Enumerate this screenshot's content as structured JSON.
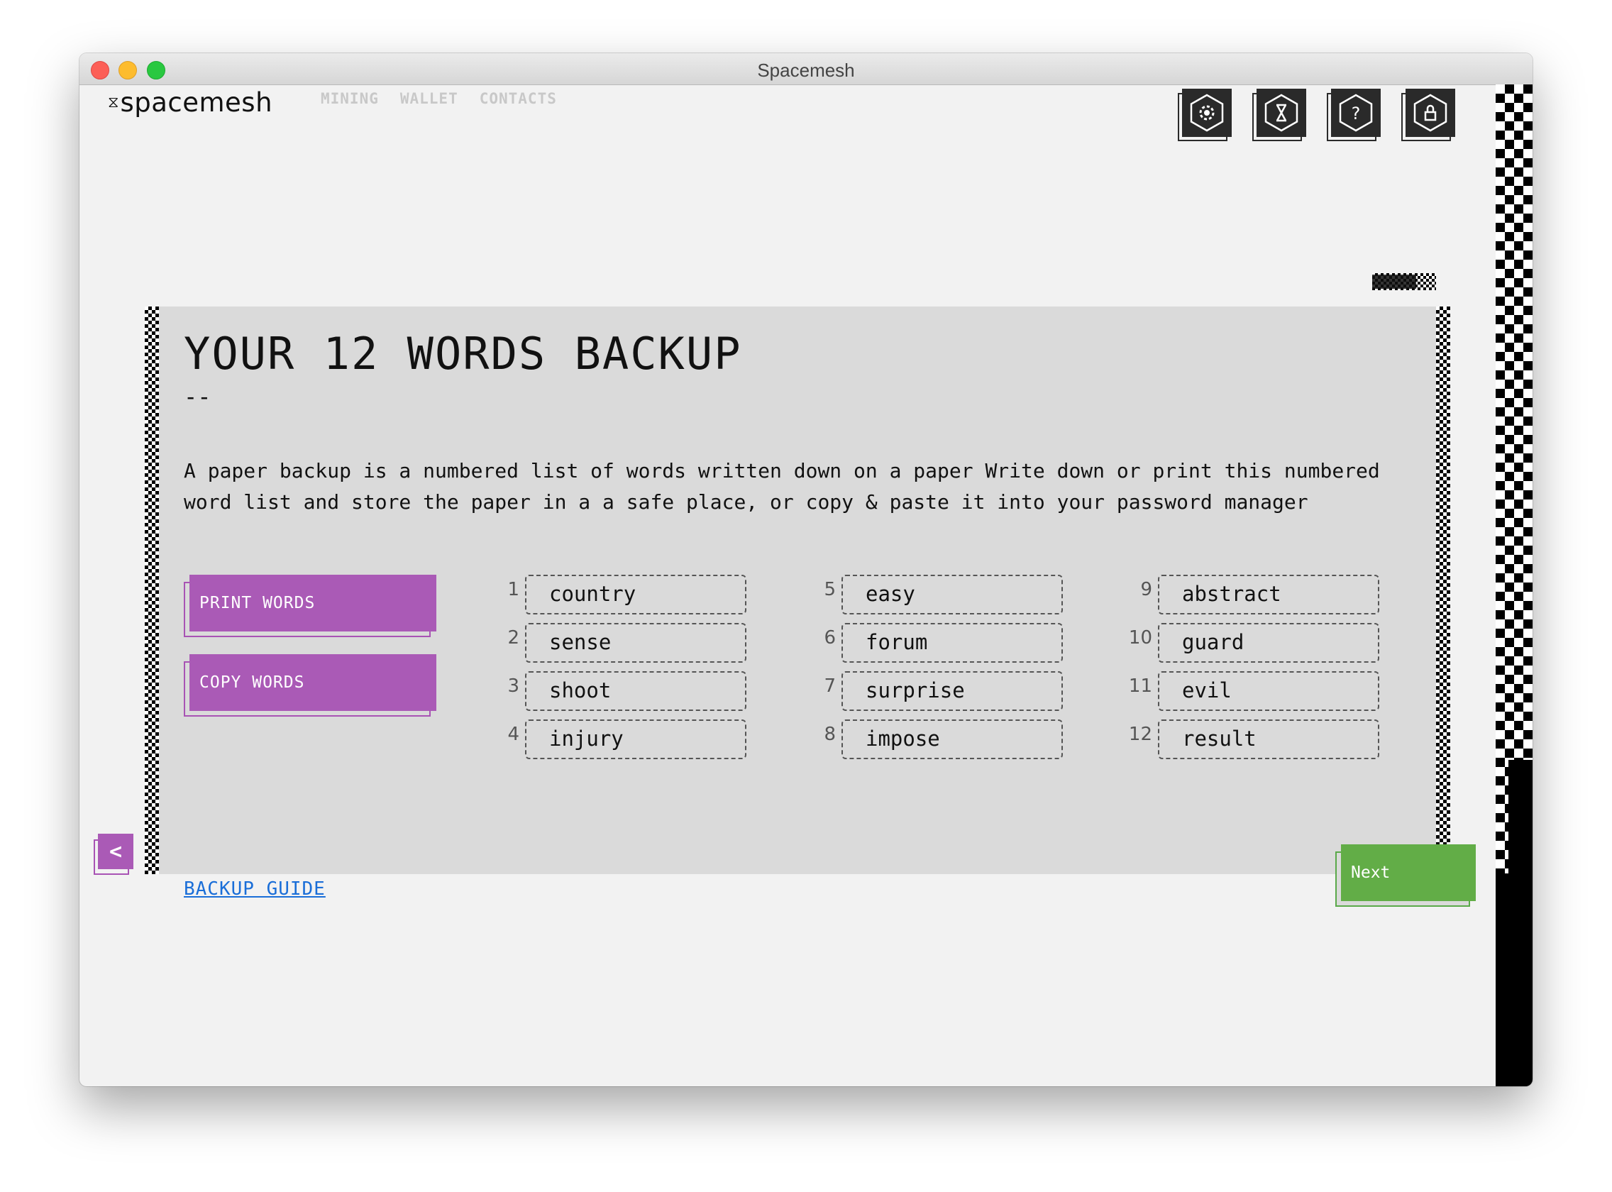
{
  "window": {
    "title": "Spacemesh"
  },
  "logo": {
    "mark": "⧖",
    "text": "spacemesh"
  },
  "nav": {
    "items": [
      "MINING",
      "WALLET",
      "CONTACTS"
    ]
  },
  "top_icons": [
    "settings-gear-icon",
    "hourglass-icon",
    "help-question-icon",
    "lock-icon"
  ],
  "page": {
    "title": "YOUR 12 WORDS BACKUP",
    "dash": "--",
    "description": "A paper backup is a numbered list of words written down on a paper Write down or print this numbered word list and store the paper in a a safe place, or copy & paste it into your password manager"
  },
  "buttons": {
    "print": "PRINT WORDS",
    "copy": "COPY WORDS",
    "next": "Next",
    "guide": "BACKUP GUIDE",
    "back": "<"
  },
  "words": [
    {
      "num": "1",
      "word": "country"
    },
    {
      "num": "2",
      "word": "sense"
    },
    {
      "num": "3",
      "word": "shoot"
    },
    {
      "num": "4",
      "word": "injury"
    },
    {
      "num": "5",
      "word": "easy"
    },
    {
      "num": "6",
      "word": "forum"
    },
    {
      "num": "7",
      "word": "surprise"
    },
    {
      "num": "8",
      "word": "impose"
    },
    {
      "num": "9",
      "word": "abstract"
    },
    {
      "num": "10",
      "word": "guard"
    },
    {
      "num": "11",
      "word": "evil"
    },
    {
      "num": "12",
      "word": "result"
    }
  ],
  "colors": {
    "accent_purple": "#aa5ab6",
    "next_green": "#62ad47",
    "link_blue": "#1a6ed8",
    "panel_bg": "#dadada"
  }
}
